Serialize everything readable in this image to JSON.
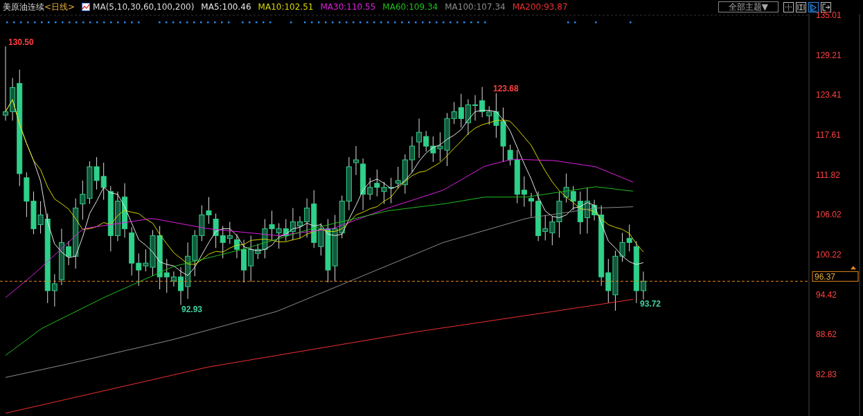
{
  "instrument": {
    "name": "美原油连续",
    "period": "<日线>"
  },
  "indicator": {
    "label": "MA(5,10,30,60,100,200)"
  },
  "ma_values": [
    {
      "text": "MA5:100.46",
      "color": "#e8e8e8"
    },
    {
      "text": "MA10:102.51",
      "color": "#d8d800"
    },
    {
      "text": "MA30:110.55",
      "color": "#e020e0"
    },
    {
      "text": "MA60:109.34",
      "color": "#20c020"
    },
    {
      "text": "MA100:107.34",
      "color": "#8c8c8c"
    },
    {
      "text": "MA200:93.87",
      "color": "#f03030"
    }
  ],
  "theme_dropdown": {
    "label": "全部主题▼"
  },
  "toolbar_buttons": [
    {
      "selected": false
    },
    {
      "selected": false
    },
    {
      "selected": true
    },
    {
      "selected": false
    }
  ],
  "price_axis": {
    "ticks": [
      "135.01",
      "129.21",
      "123.41",
      "117.61",
      "111.82",
      "106.02",
      "100.22",
      "94.42",
      "88.62",
      "82.83"
    ]
  },
  "annotations": [
    {
      "text": "130.50",
      "kind": "high"
    },
    {
      "text": "92.93",
      "kind": "low"
    },
    {
      "text": "123.68",
      "kind": "high"
    },
    {
      "text": "93.72",
      "kind": "low"
    }
  ],
  "last_price": "96.37"
}
